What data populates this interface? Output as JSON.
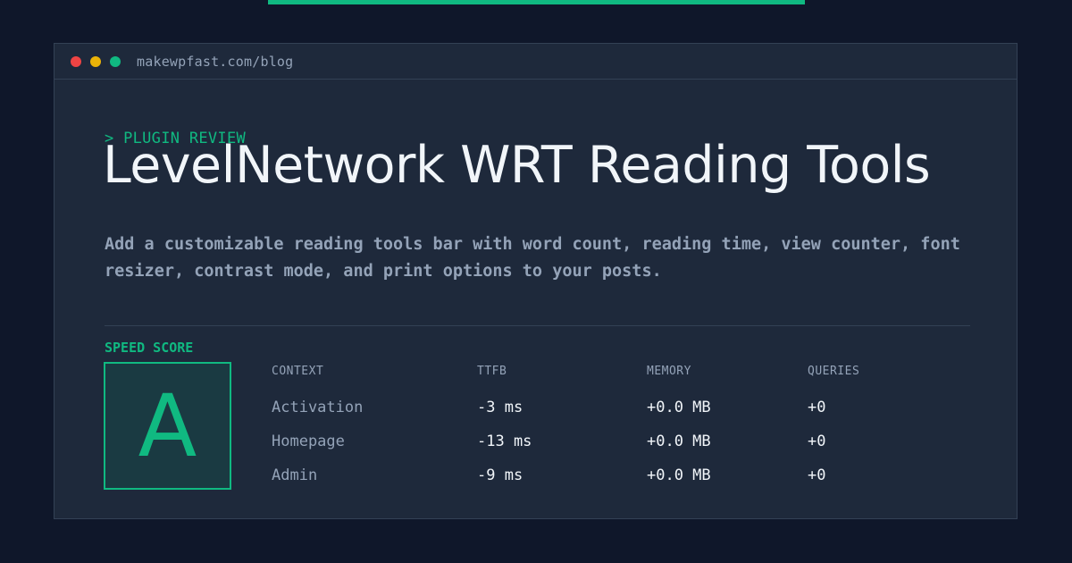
{
  "window": {
    "url": "makewpfast.com/blog"
  },
  "post": {
    "eyebrow": "> PLUGIN REVIEW",
    "title": "LevelNetwork WRT Reading Tools",
    "description": "Add a customizable reading tools bar with word count, reading time, view counter, font resizer, contrast mode, and print options to your posts."
  },
  "score": {
    "label": "SPEED SCORE",
    "grade": "A"
  },
  "table": {
    "headers": [
      "CONTEXT",
      "TTFB",
      "MEMORY",
      "QUERIES"
    ],
    "rows": [
      {
        "context": "Activation",
        "ttfb": "-3 ms",
        "memory": "+0.0 MB",
        "queries": "+0"
      },
      {
        "context": "Homepage",
        "ttfb": "-13 ms",
        "memory": "+0.0 MB",
        "queries": "+0"
      },
      {
        "context": "Admin",
        "ttfb": "-9 ms",
        "memory": "+0.0 MB",
        "queries": "+0"
      }
    ]
  },
  "colors": {
    "accent": "#10b981",
    "background": "#0f172a",
    "panel": "#1e293b"
  }
}
